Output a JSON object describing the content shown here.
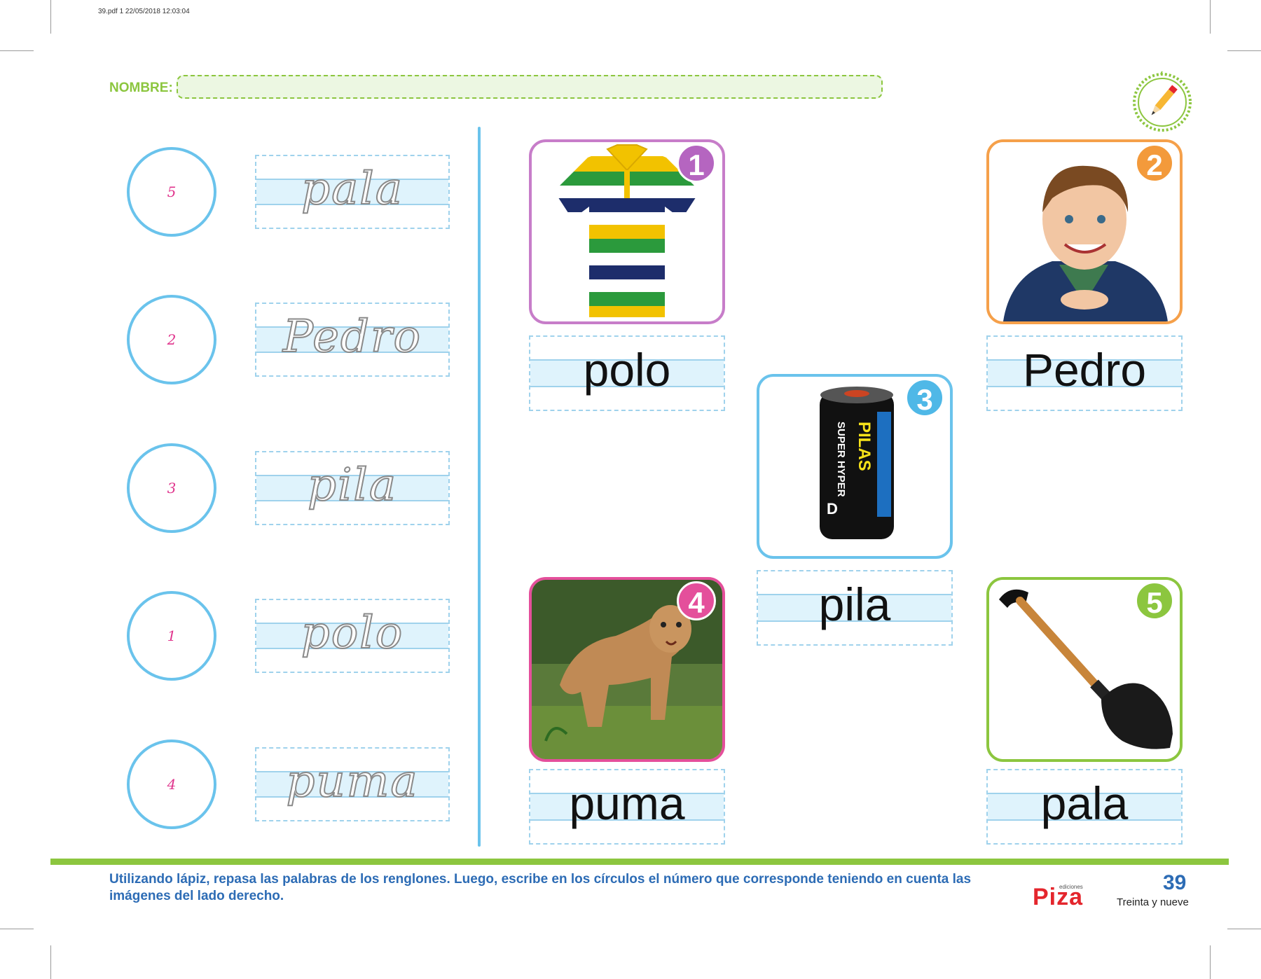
{
  "header": {
    "pdf_info": "39.pdf  1  22/05/2018  12:03:04",
    "name_label": "NOMBRE:"
  },
  "colors": {
    "accent_green": "#8cc63f",
    "accent_blue": "#6ac3ec",
    "number_pink": "#e0338c",
    "instruction_blue": "#2d6cb5",
    "brand_red": "#e4262d"
  },
  "tracing": {
    "rows": [
      {
        "circle_number": "5",
        "word": "pala"
      },
      {
        "circle_number": "2",
        "word": "Pedro"
      },
      {
        "circle_number": "3",
        "word": "pila"
      },
      {
        "circle_number": "1",
        "word": "polo"
      },
      {
        "circle_number": "4",
        "word": "puma"
      }
    ]
  },
  "pictures": [
    {
      "number": "1",
      "word": "polo",
      "image": "striped-polo-shirt",
      "color": "#c77dc9"
    },
    {
      "number": "2",
      "word": "Pedro",
      "image": "smiling-boy",
      "color": "#f5a04a"
    },
    {
      "number": "3",
      "word": "pila",
      "image": "battery",
      "color": "#6ac3ec",
      "battery_text": "PILAS",
      "battery_subtext": "SUPER HYPER",
      "battery_size": "D"
    },
    {
      "number": "4",
      "word": "puma",
      "image": "puma",
      "color": "#e44f9b"
    },
    {
      "number": "5",
      "word": "pala",
      "image": "shovel",
      "color": "#8cc63f"
    }
  ],
  "footer": {
    "instructions": "Utilizando lápiz, repasa las palabras de los renglones. Luego, escribe en los círculos el número que corresponde teniendo en cuenta las imágenes del lado derecho.",
    "brand_small": "ediciones",
    "brand": "Piza",
    "page_number": "39",
    "page_words": "Treinta y nueve"
  }
}
